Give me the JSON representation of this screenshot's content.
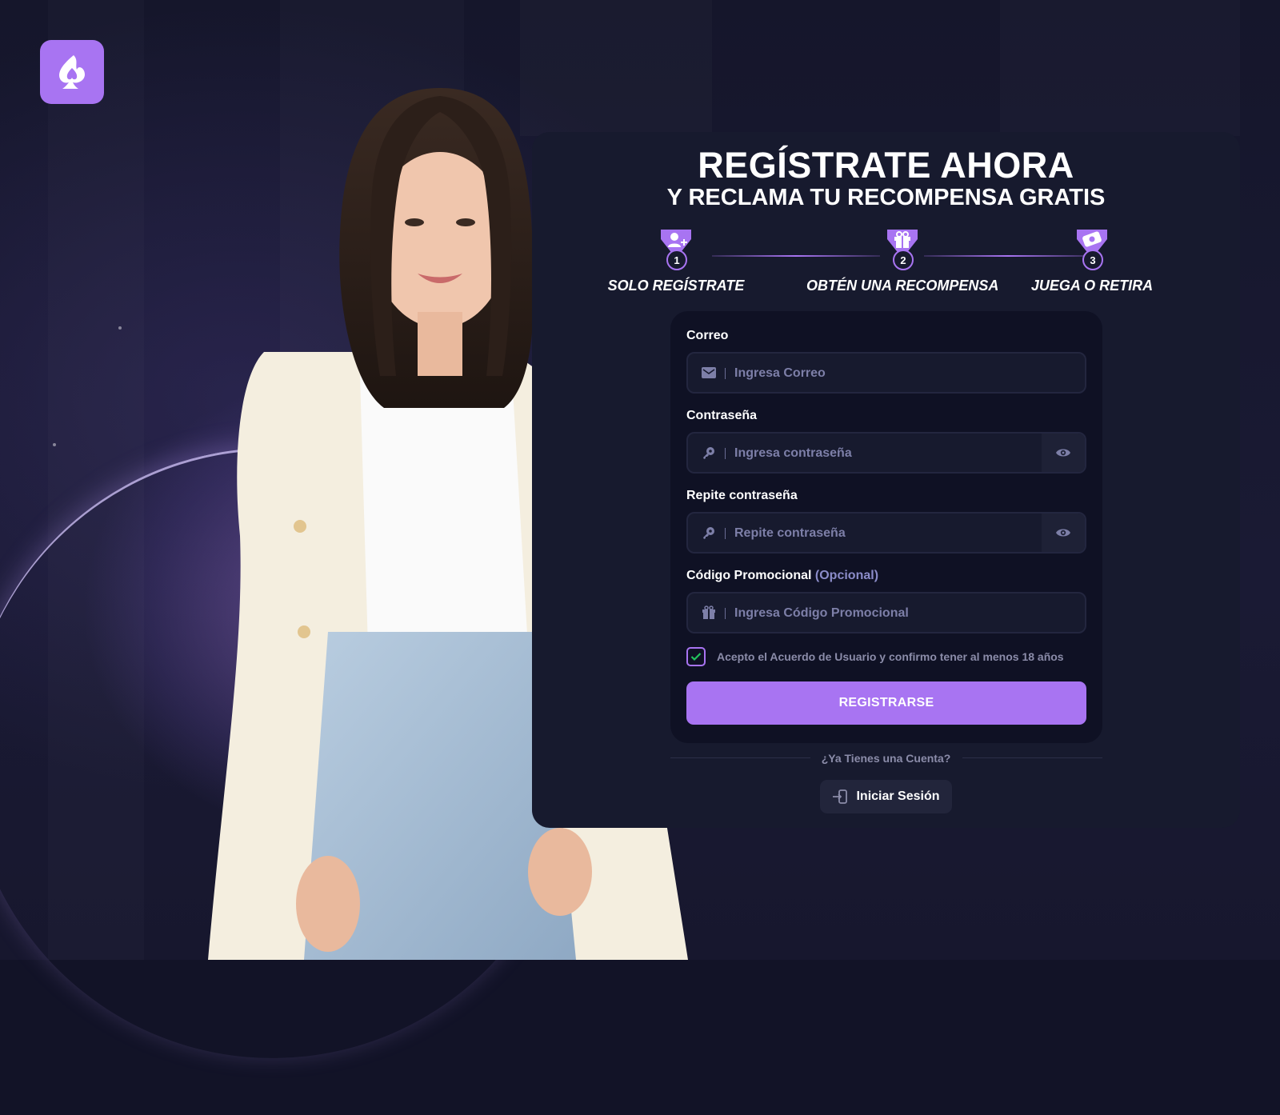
{
  "hero": {
    "title": "REGÍSTRATE AHORA",
    "subtitle": "Y RECLAMA TU RECOMPENSA GRATIS"
  },
  "steps": [
    {
      "num": "1",
      "label": "SOLO REGÍSTRATE",
      "icon": "user-plus-icon"
    },
    {
      "num": "2",
      "label": "OBTÉN UNA RECOMPENSA",
      "icon": "gift-icon"
    },
    {
      "num": "3",
      "label": "JUEGA O RETIRA",
      "icon": "cash-icon"
    }
  ],
  "form": {
    "email": {
      "label": "Correo",
      "placeholder": "Ingresa Correo"
    },
    "password": {
      "label": "Contraseña",
      "placeholder": "Ingresa contraseña"
    },
    "repeat_password": {
      "label": "Repite contraseña",
      "placeholder": "Repite contraseña"
    },
    "promo": {
      "label": "Código Promocional",
      "optional": "(Opcional)",
      "placeholder": "Ingresa Código Promocional"
    },
    "terms": {
      "label": "Acepto el Acuerdo de Usuario y confirmo tener al menos 18 años",
      "checked": true
    },
    "submit_label": "REGISTRARSE"
  },
  "footer": {
    "already_text": "¿Ya Tienes una Cuenta?",
    "login_label": "Iniciar Sesión"
  },
  "colors": {
    "accent": "#a874f2",
    "card": "#171a2e",
    "form": "#0f1124",
    "check": "#22c55e"
  }
}
